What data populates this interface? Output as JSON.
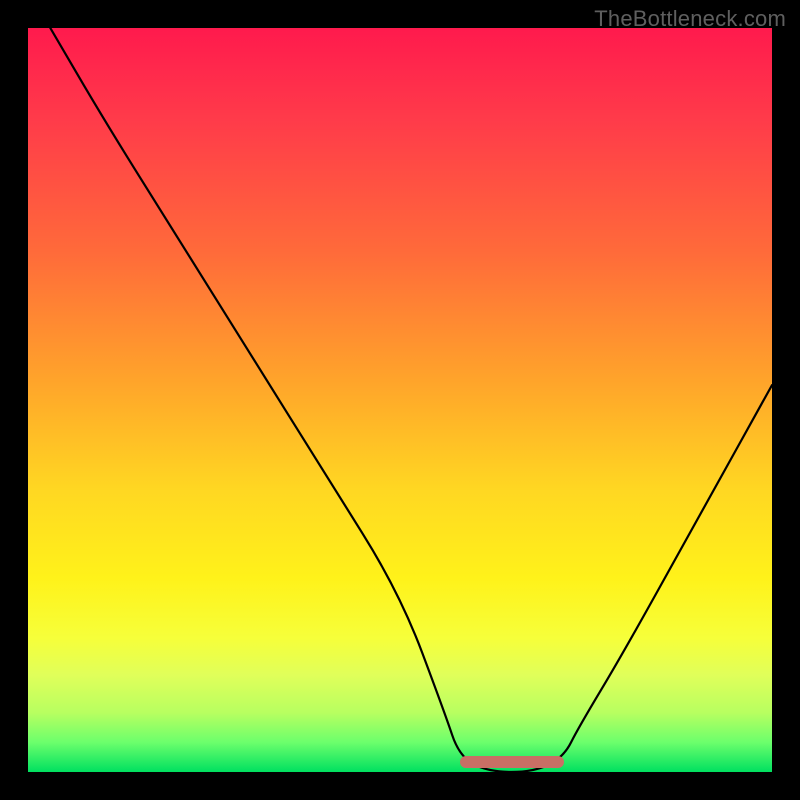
{
  "watermark": "TheBottleneck.com",
  "chart_data": {
    "type": "line",
    "title": "",
    "xlabel": "",
    "ylabel": "",
    "xlim": [
      0,
      100
    ],
    "ylim": [
      0,
      100
    ],
    "grid": false,
    "legend": false,
    "series": [
      {
        "name": "bottleneck-curve",
        "x": [
          3,
          10,
          20,
          30,
          40,
          50,
          56,
          58,
          62,
          68,
          72,
          74,
          80,
          90,
          100
        ],
        "values": [
          100,
          88,
          72,
          56,
          40,
          24,
          8,
          2,
          0,
          0,
          2,
          6,
          16,
          34,
          52
        ]
      }
    ],
    "annotations": [
      {
        "name": "optimal-range-marker",
        "x_start": 58,
        "x_end": 72,
        "y": 0,
        "color": "#c96f65"
      }
    ],
    "background_gradient": {
      "direction": "vertical",
      "stops": [
        {
          "pos": 0.0,
          "color": "#ff1a4d"
        },
        {
          "pos": 0.3,
          "color": "#ff6a3a"
        },
        {
          "pos": 0.62,
          "color": "#ffd722"
        },
        {
          "pos": 0.82,
          "color": "#f6ff3a"
        },
        {
          "pos": 1.0,
          "color": "#00e060"
        }
      ]
    }
  }
}
